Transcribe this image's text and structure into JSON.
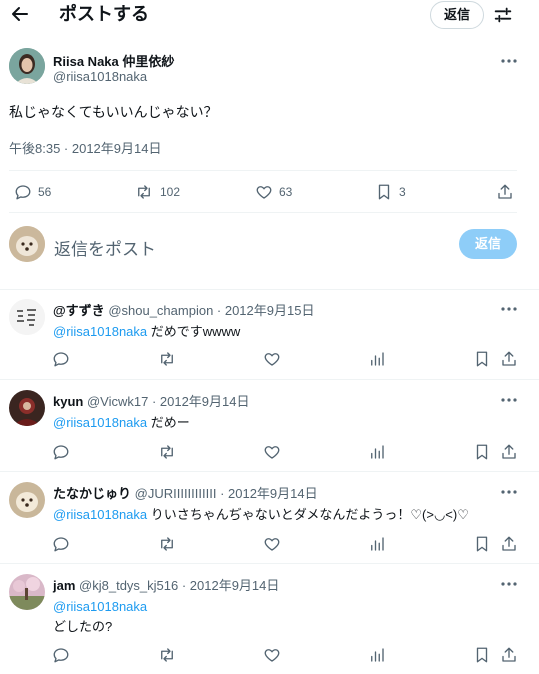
{
  "header": {
    "title": "ポストする",
    "reply_label": "返信"
  },
  "post": {
    "name": "Riisa Naka 仲里依紗",
    "handle": "@riisa1018naka",
    "text": "私じゃなくてもいいんじゃない？",
    "time": "午後8:35 · 2012年9月14日",
    "stats": {
      "replies": "56",
      "reposts": "102",
      "likes": "63",
      "bookmarks": "3"
    }
  },
  "compose": {
    "placeholder": "返信をポスト",
    "button_label": "返信"
  },
  "replies": [
    {
      "name": "@すずき",
      "meta": "@shou_champion · 2012年9月15日",
      "mention": "@riisa1018naka",
      "text": " だめですwwww"
    },
    {
      "name": "kyun",
      "meta": "@Vicwk17 · 2012年9月14日",
      "mention": "@riisa1018naka",
      "text": " だめー"
    },
    {
      "name": "たなかじゅり",
      "meta": "@JURIIIIIIIIIIII · 2012年9月14日",
      "mention": "@riisa1018naka",
      "text": " りいさちゃんぢゃないとダメなんだようっ！♡(>◡<)♡"
    },
    {
      "name": "jam",
      "meta": "@kj8_tdys_kj516 · 2012年9月14日",
      "mention": "@riisa1018naka",
      "text": "どしたの?"
    }
  ]
}
